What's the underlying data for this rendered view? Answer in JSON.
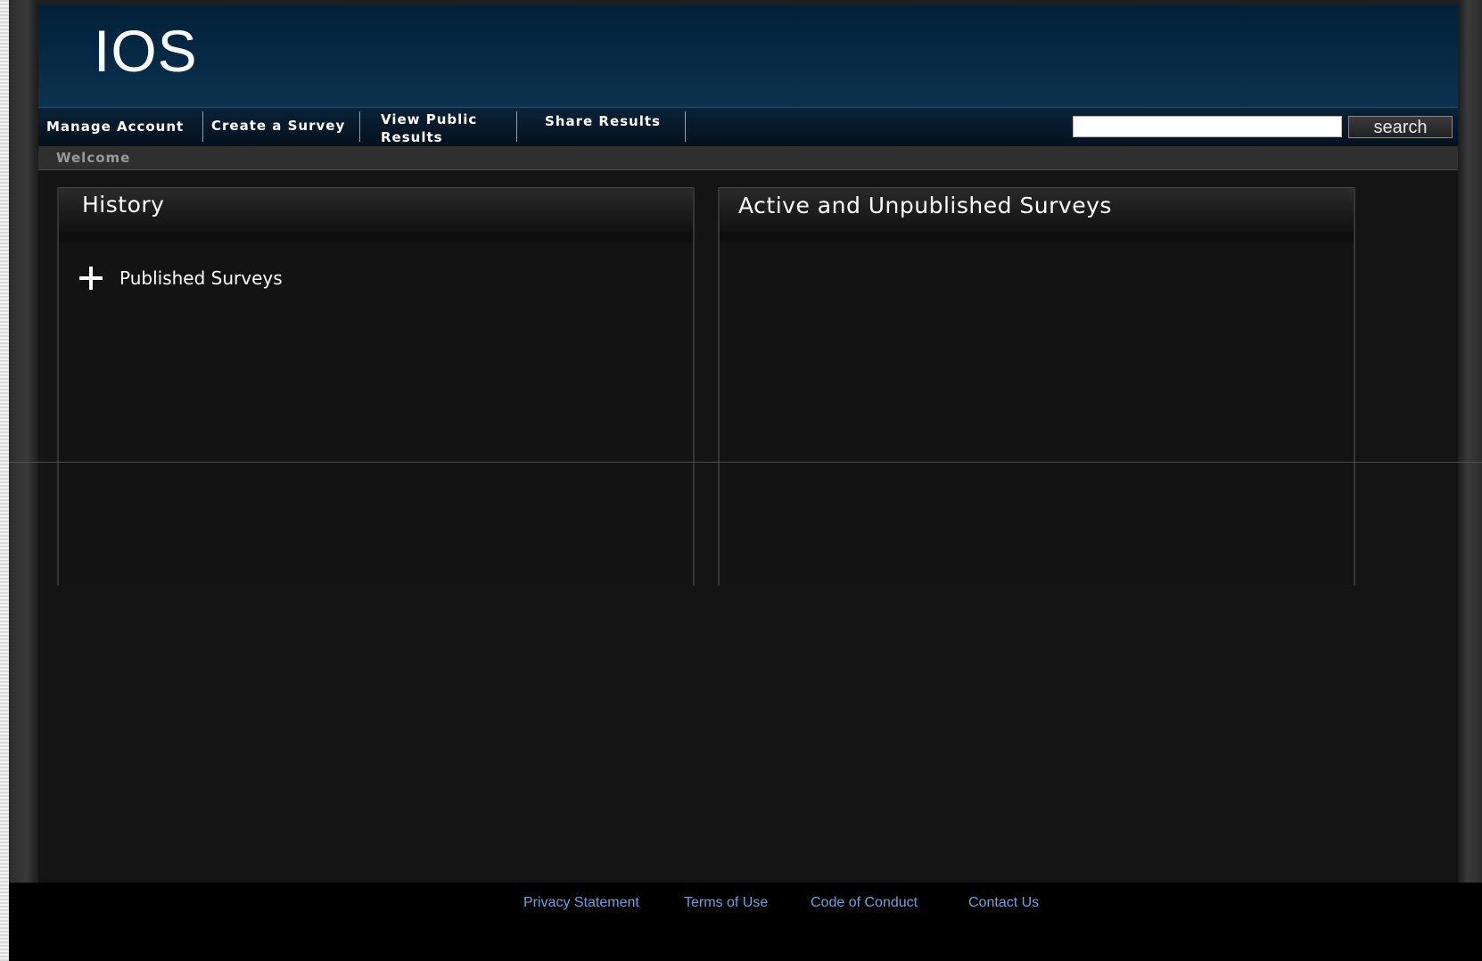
{
  "header": {
    "logo_text": "IOS"
  },
  "nav": {
    "items": [
      {
        "label": "Manage Account"
      },
      {
        "label": "Create a Survey"
      },
      {
        "label": "View Public Results"
      },
      {
        "label": "Share Results"
      }
    ],
    "search": {
      "value": "",
      "placeholder": "",
      "button_label": "search"
    }
  },
  "breadcrumb": {
    "label": "Welcome"
  },
  "panels": {
    "history": {
      "title": "History",
      "items": [
        {
          "label": "Published Surveys",
          "icon": "plus-icon"
        }
      ]
    },
    "active": {
      "title": "Active and Unpublished Surveys"
    }
  },
  "footer": {
    "links": [
      {
        "label": "Privacy Statement"
      },
      {
        "label": "Terms of Use"
      },
      {
        "label": "Code of Conduct"
      },
      {
        "label": "Contact Us"
      }
    ]
  },
  "colors": {
    "banner": "#062a45",
    "page_background": "#141414",
    "footer_link": "#6fa0e0"
  }
}
